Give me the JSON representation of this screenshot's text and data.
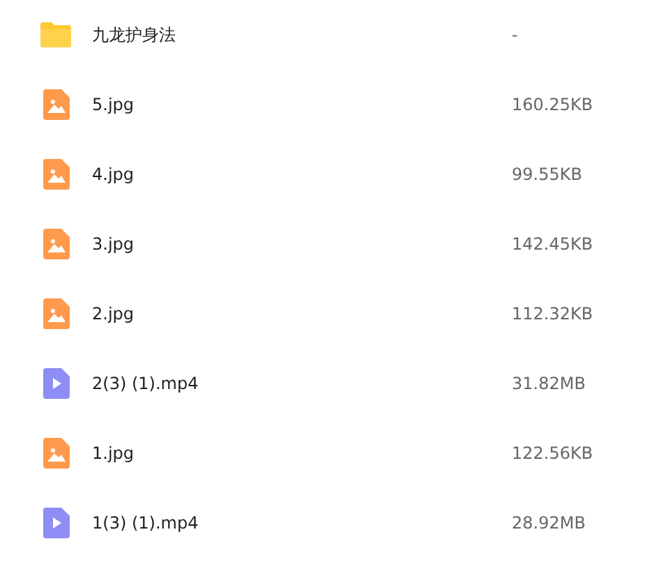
{
  "files": [
    {
      "kind": "folder",
      "name": "九龙护身法",
      "size": "-"
    },
    {
      "kind": "image",
      "name": "5.jpg",
      "size": "160.25KB"
    },
    {
      "kind": "image",
      "name": "4.jpg",
      "size": "99.55KB"
    },
    {
      "kind": "image",
      "name": "3.jpg",
      "size": "142.45KB"
    },
    {
      "kind": "image",
      "name": "2.jpg",
      "size": "112.32KB"
    },
    {
      "kind": "video",
      "name": "2(3) (1).mp4",
      "size": "31.82MB"
    },
    {
      "kind": "image",
      "name": "1.jpg",
      "size": "122.56KB"
    },
    {
      "kind": "video",
      "name": "1(3) (1).mp4",
      "size": "28.92MB"
    }
  ]
}
